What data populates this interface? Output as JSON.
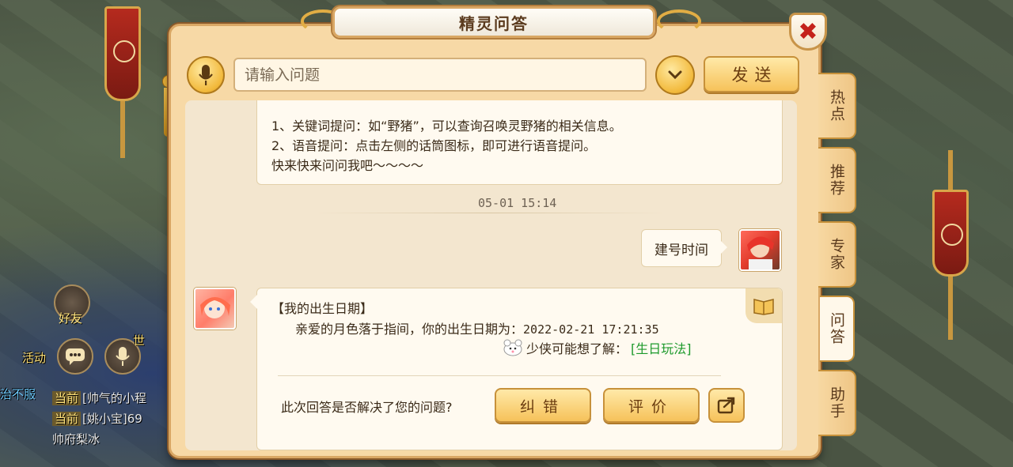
{
  "hud": {
    "friends_label": "好友",
    "activity_label": "活动",
    "world_label": "世",
    "chat_lines": [
      {
        "tag": "当前",
        "text": "[帅气的小程"
      },
      {
        "tag": "当前",
        "text": "[姚小宝]69"
      },
      {
        "tag": "",
        "text": "帅府梨冰"
      }
    ],
    "partial_left_text": "治不服"
  },
  "window": {
    "title": "精灵问答",
    "close_label": "✖"
  },
  "input": {
    "placeholder": "请输入问题",
    "value": "",
    "send_label": "发送"
  },
  "chat": {
    "system_lines": [
      "1、关键词提问：如“野猪”，可以查询召唤灵野猪的相关信息。",
      "2、语音提问：点击左侧的话筒图标，即可进行语音提问。",
      "快来快来问问我吧～～～～"
    ],
    "timestamp": "05-01 15:14",
    "user_message": "建号时间",
    "bot_reply": {
      "title": "【我的出生日期】",
      "body_prefix": "亲爱的月色落于指间，你的出生日期为：",
      "birth_date": "2022-02-21 17:21:35",
      "hint_prefix": "少侠可能想了解：",
      "hint_link": "[生日玩法]",
      "question": "此次回答是否解决了您的问题?",
      "correct_label": "纠错",
      "rate_label": "评价"
    }
  },
  "tabs": [
    {
      "label": "热点",
      "active": false
    },
    {
      "label": "推荐",
      "active": false
    },
    {
      "label": "专家",
      "active": false
    },
    {
      "label": "问答",
      "active": true
    },
    {
      "label": "助手",
      "active": false
    }
  ],
  "colors": {
    "panel_bg": "#f7d9a6",
    "gold_button": "#f6c25a",
    "close_red": "#c4221b",
    "link_green": "#1d9a2c"
  }
}
